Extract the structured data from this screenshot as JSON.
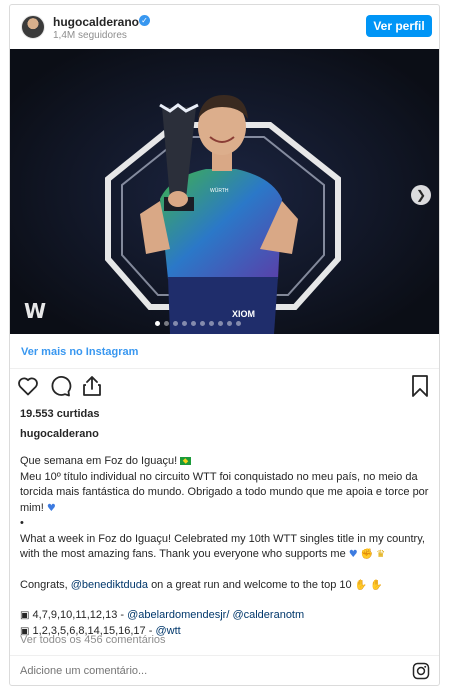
{
  "header": {
    "username": "hugocalderano",
    "followers": "1,4M seguidores",
    "profile_button": "Ver perfil"
  },
  "photo": {
    "brand_text": "XIOM",
    "sponsor_text": "WÜRTH",
    "next_arrow": "chevron-right-icon",
    "carousel_dots": 10,
    "active_dot": 1
  },
  "see_more": "Ver mais no Instagram",
  "likes": "19.553 curtidas",
  "caption": {
    "username": "hugocalderano",
    "line1": "Que semana em Foz do Iguaçu!",
    "line2": "Meu 10º título individual no circuito WTT foi conquistado no meu país, no meio da torcida mais fantástica do mundo. Obrigado a todo mundo que me apoia e torce por mim!",
    "bullet": "•",
    "line3": "What a week in Foz do Iguaçu! Celebrated my 10th WTT singles title in my country, with the most amazing fans. Thank you everyone who supports me",
    "congrats_prefix": "Congrats,",
    "congrats_mention": "@benediktduda",
    "congrats_suffix": "on a great run and welcome to the top 10",
    "photo_credit_1_nums": "4,7,9,10,11,12,13 -",
    "photo_credit_1_mentions": "@abelardomendesjr/ @calderanotm",
    "photo_credit_2_nums": "1,2,3,5,6,8,14,15,16,17 -",
    "photo_credit_2_mentions": "@wtt"
  },
  "comments_link": "Ver todos os 456 comentários",
  "comment_placeholder": "Adicione um comentário...",
  "colors": {
    "accent_blue": "#0095f6",
    "link_blue": "#3897f0",
    "mention_blue": "#00376b",
    "muted": "#8e8e8e"
  }
}
